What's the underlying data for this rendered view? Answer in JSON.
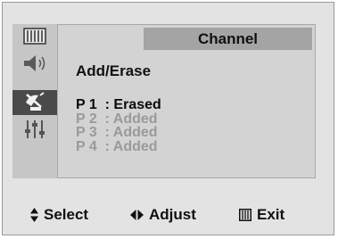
{
  "menu": {
    "title": "Channel",
    "heading": "Add/Erase",
    "icons": [
      "picture-icon",
      "sound-icon",
      "channel-antenna-icon",
      "setup-sliders-icon",
      "blank-icon"
    ],
    "active_icon_index": 2,
    "programs": [
      {
        "label": "P 1  : Erased",
        "selected": true
      },
      {
        "label": "P 2  : Added",
        "selected": false
      },
      {
        "label": "P 3  : Added",
        "selected": false
      },
      {
        "label": "P 4  : Added",
        "selected": false
      }
    ]
  },
  "footer": {
    "select_label": "Select",
    "adjust_label": "Adjust",
    "exit_label": "Exit",
    "select_icon": "up-down-arrows-icon",
    "adjust_icon": "left-right-arrows-icon",
    "exit_icon": "menu-icon"
  },
  "colors": {
    "background": "#e3e3e3",
    "panel": "#d3d3d3",
    "title_bar": "#a4a4a4",
    "active_icon_bg": "#4a4a4a",
    "dim_text": "#9a9a9a"
  }
}
